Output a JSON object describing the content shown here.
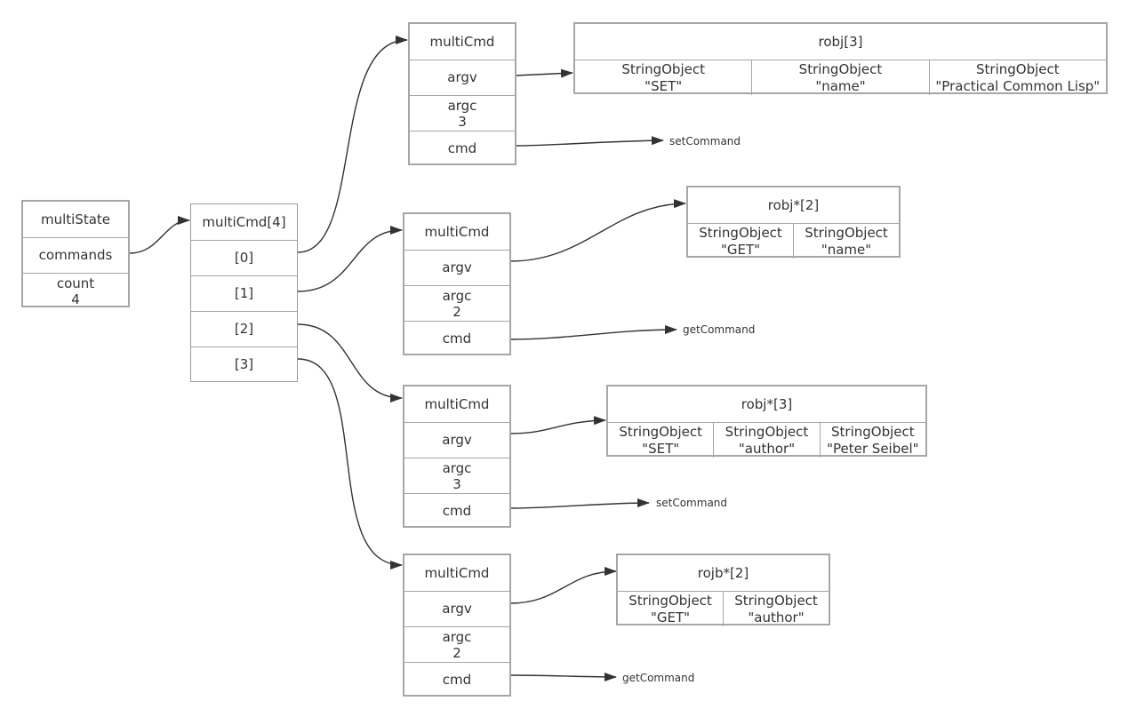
{
  "multiState": {
    "title": "multiState",
    "commands": "commands",
    "count_label": "count",
    "count_value": "4"
  },
  "multiCmdArray": {
    "title": "multiCmd[4]",
    "slots": [
      "[0]",
      "[1]",
      "[2]",
      "[3]"
    ]
  },
  "multiCmds": [
    {
      "title": "multiCmd",
      "argv": "argv",
      "argc_label": "argc",
      "argc_value": "3",
      "cmd": "cmd",
      "command_target": "setCommand",
      "robj": {
        "title": "robj[3]",
        "items": [
          {
            "type": "StringObject",
            "value": "\"SET\""
          },
          {
            "type": "StringObject",
            "value": "\"name\""
          },
          {
            "type": "StringObject",
            "value": "\"Practical Common Lisp\""
          }
        ]
      }
    },
    {
      "title": "multiCmd",
      "argv": "argv",
      "argc_label": "argc",
      "argc_value": "2",
      "cmd": "cmd",
      "command_target": "getCommand",
      "robj": {
        "title": "robj*[2]",
        "items": [
          {
            "type": "StringObject",
            "value": "\"GET\""
          },
          {
            "type": "StringObject",
            "value": "\"name\""
          }
        ]
      }
    },
    {
      "title": "multiCmd",
      "argv": "argv",
      "argc_label": "argc",
      "argc_value": "3",
      "cmd": "cmd",
      "command_target": "setCommand",
      "robj": {
        "title": "robj*[3]",
        "items": [
          {
            "type": "StringObject",
            "value": "\"SET\""
          },
          {
            "type": "StringObject",
            "value": "\"author\""
          },
          {
            "type": "StringObject",
            "value": "\"Peter Seibel\""
          }
        ]
      }
    },
    {
      "title": "multiCmd",
      "argv": "argv",
      "argc_label": "argc",
      "argc_value": "2",
      "cmd": "cmd",
      "command_target": "getCommand",
      "robj": {
        "title": "rojb*[2]",
        "items": [
          {
            "type": "StringObject",
            "value": "\"GET\""
          },
          {
            "type": "StringObject",
            "value": "\"author\""
          }
        ]
      }
    }
  ],
  "colors": {
    "edge": "#333333",
    "border": "#a6a6a6",
    "text": "#333333"
  }
}
